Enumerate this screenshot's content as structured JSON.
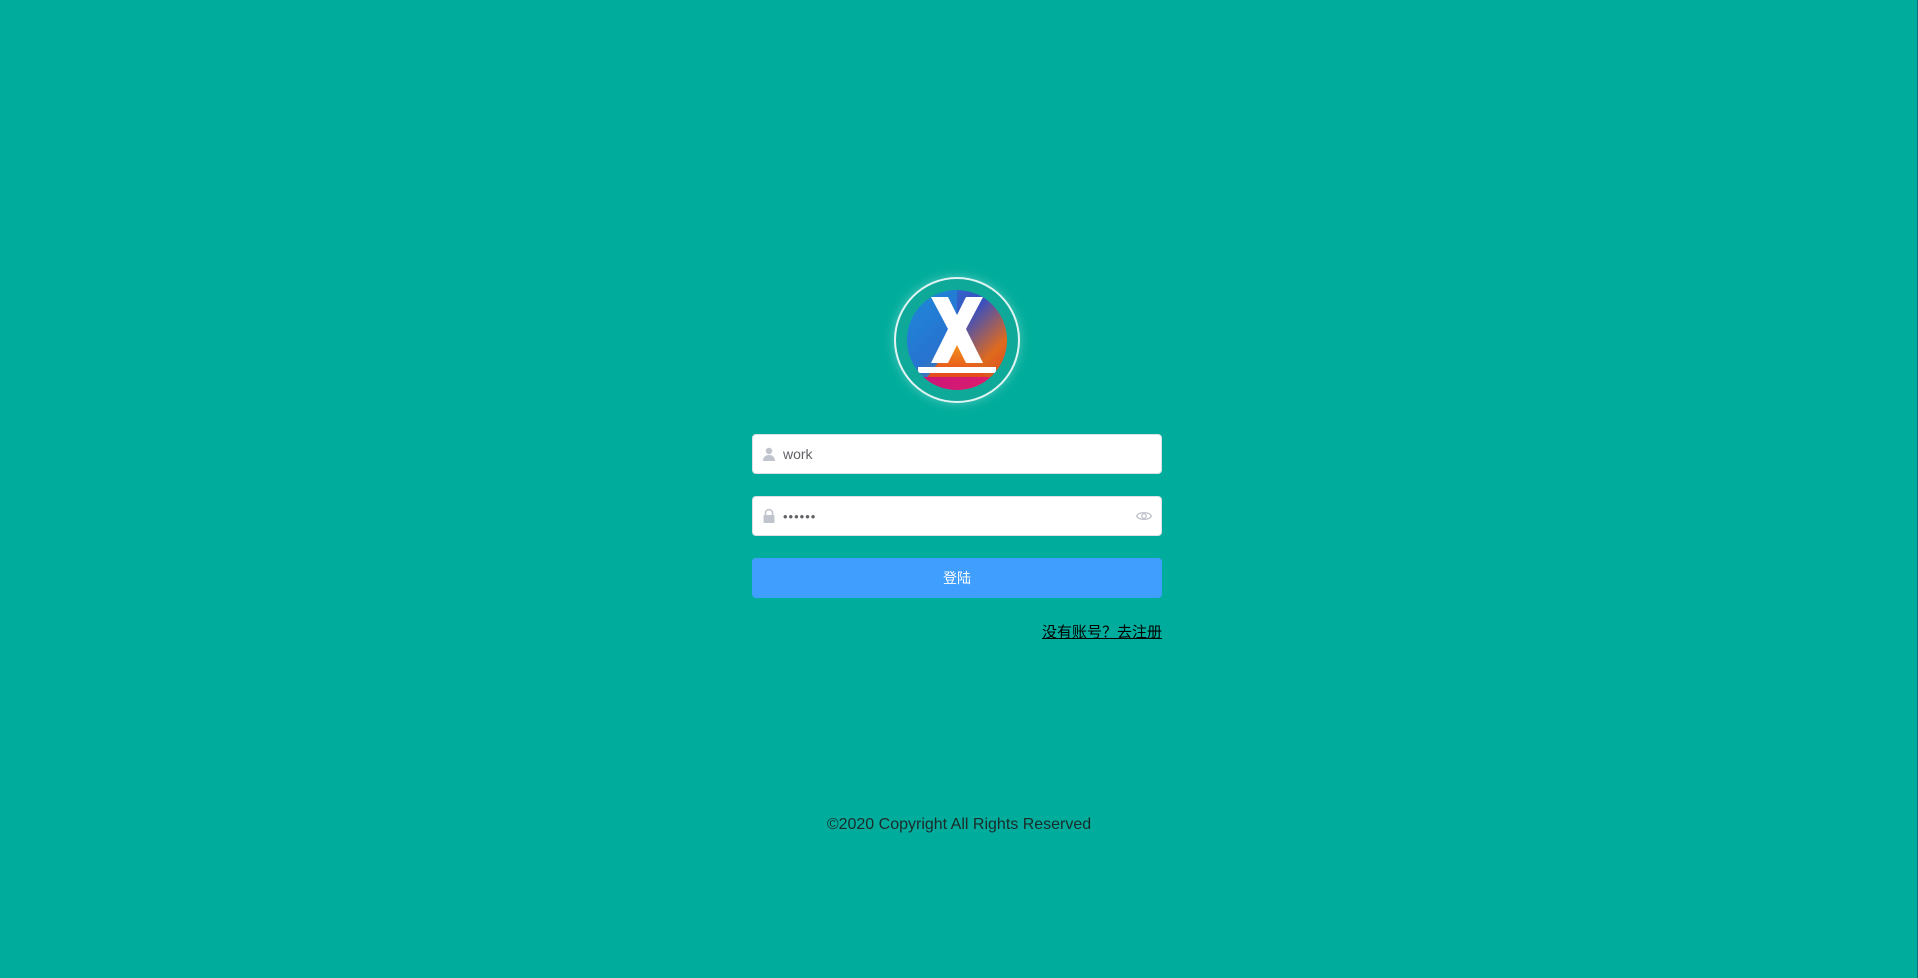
{
  "page": {
    "background_color": "#00ad9c"
  },
  "logo": {
    "icon": "x-logo-icon",
    "letter": "X"
  },
  "login_form": {
    "username": {
      "value": "work",
      "placeholder": "",
      "icon": "user-icon"
    },
    "password": {
      "value": "••••••",
      "placeholder": "",
      "icon": "lock-icon",
      "toggle_icon": "eye-icon"
    },
    "login_button_label": "登陆",
    "register_link_label": "没有账号？去注册"
  },
  "footer": {
    "copyright": "©2020 Copyright All Rights Reserved"
  },
  "colors": {
    "primary_button": "#409eff",
    "input_border": "#dcdfe6",
    "icon_gray": "#c0c4cc"
  }
}
